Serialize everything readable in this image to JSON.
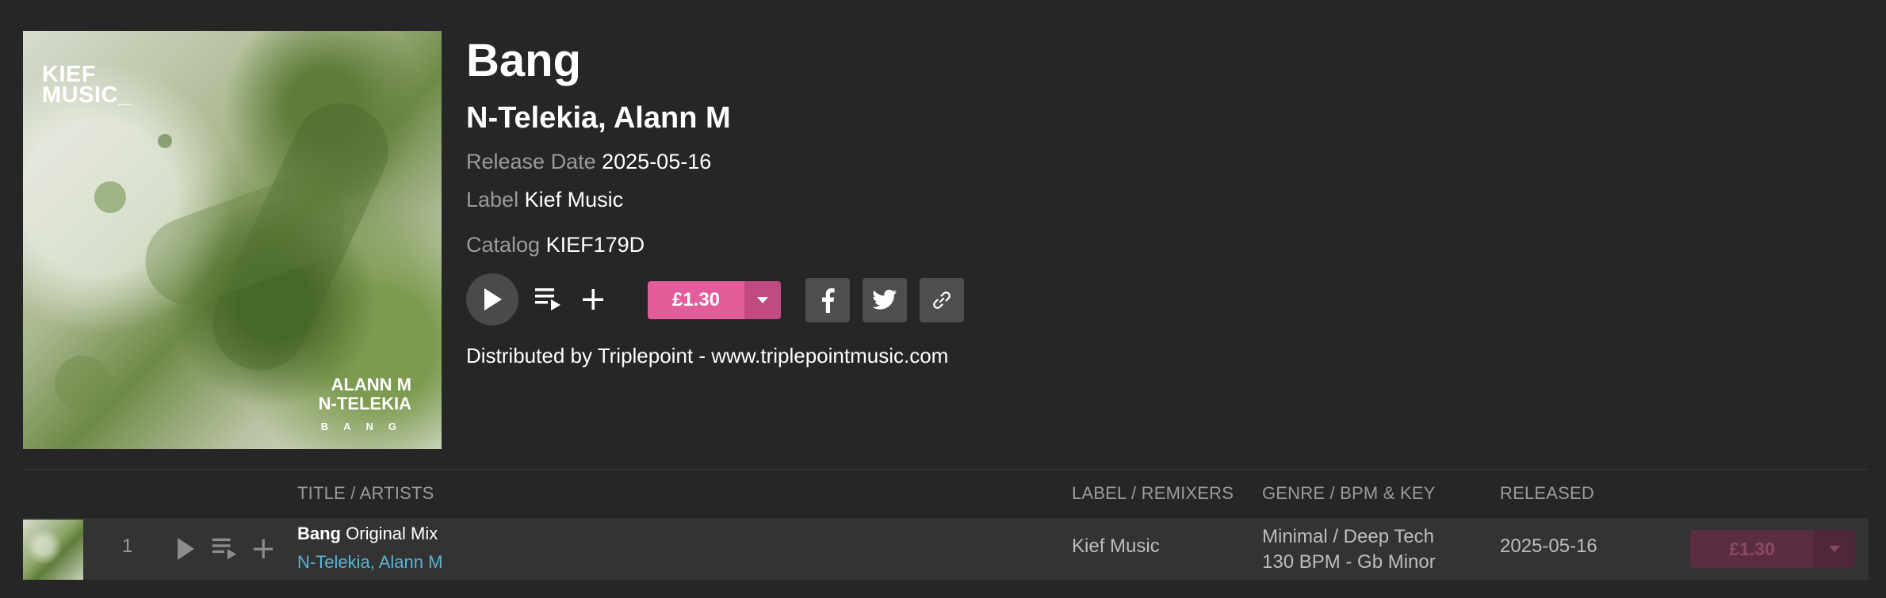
{
  "release": {
    "title": "Bang",
    "artists": "N-Telekia, Alann M",
    "release_date_label": "Release Date",
    "release_date": "2025-05-16",
    "label_label": "Label",
    "label": "Kief Music",
    "catalog_label": "Catalog",
    "catalog": "KIEF179D",
    "price": "£1.30",
    "distributed": "Distributed by Triplepoint - www.triplepointmusic.com"
  },
  "cover": {
    "logo_line1": "KIEF",
    "logo_line2": "MUSIC_",
    "artist_line1": "ALANN M",
    "artist_line2": "N-TELEKIA",
    "title_spaced": "BANG"
  },
  "icons": {
    "play": "play-icon",
    "queue": "add-to-queue-icon",
    "add": "plus-icon",
    "dropdown": "chevron-down-icon",
    "facebook": "facebook-icon",
    "twitter": "twitter-icon",
    "link": "link-icon"
  },
  "colors": {
    "accent": "#e35d9b",
    "artist_link": "#5ab3d6",
    "background": "#262626"
  },
  "table": {
    "headers": {
      "title": "TITLE / ARTISTS",
      "label": "LABEL / REMIXERS",
      "genre": "GENRE / BPM & KEY",
      "released": "RELEASED"
    },
    "rows": [
      {
        "number": "1",
        "title": "Bang",
        "mix": "Original Mix",
        "artists": "N-Telekia, Alann M",
        "label": "Kief Music",
        "genre": "Minimal / Deep Tech",
        "bpm_key": "130 BPM - Gb Minor",
        "released": "2025-05-16",
        "price": "£1.30"
      }
    ]
  }
}
